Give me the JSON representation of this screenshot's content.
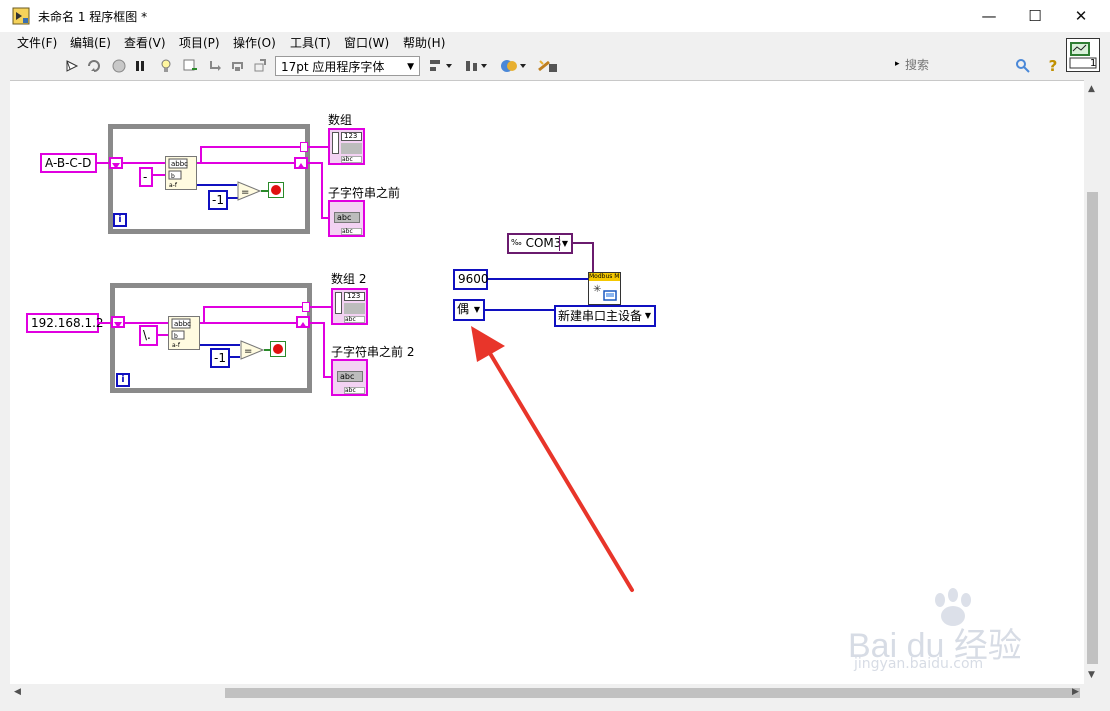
{
  "window": {
    "title": "未命名 1 程序框图 *",
    "minimize_icon": "minimize-icon",
    "maximize_icon": "maximize-icon",
    "close_icon": "close-icon"
  },
  "menu": [
    "文件(F)",
    "编辑(E)",
    "查看(V)",
    "项目(P)",
    "操作(O)",
    "工具(T)",
    "窗口(W)",
    "帮助(H)"
  ],
  "toolbar": {
    "font_select": "17pt 应用程序字体",
    "search_placeholder": "搜索",
    "help_label": "?",
    "connector_badge": "1"
  },
  "diagram": {
    "loop1": {
      "input": "A-B-C-D",
      "delimiter": "-",
      "constant": "-1",
      "label_array": "数组",
      "label_string": "子字符串之前",
      "iteration": "i",
      "array_tag": "123",
      "string_tag": "abc"
    },
    "loop2": {
      "input": "192.168.1.2",
      "delimiter": "\\.",
      "constant": "-1",
      "label_array": "数组 2",
      "label_string": "子字符串之前 2",
      "iteration": "i",
      "array_tag": "123",
      "string_tag": "abc"
    },
    "modbus": {
      "port": "COM3",
      "baud": "9600",
      "parity": "偶",
      "mode": "新建串口主设备",
      "node_label": "Modbus M"
    }
  },
  "watermark": {
    "brand": "Bai du 经验",
    "url": "jingyan.baidu.com"
  },
  "colors": {
    "string_wire": "#e000e0",
    "numeric_wire": "#1010c0",
    "arrow": "#e8352a"
  }
}
